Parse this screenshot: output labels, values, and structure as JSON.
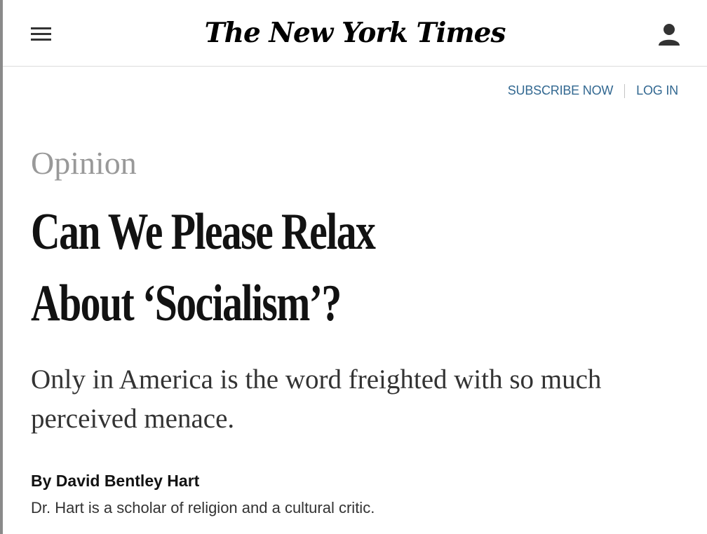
{
  "header": {
    "masthead": "The New York Times",
    "menu_icon": "hamburger-menu-icon",
    "account_icon": "user-account-icon"
  },
  "account_links": {
    "subscribe": "SUBSCRIBE NOW",
    "login": "LOG IN"
  },
  "article": {
    "kicker": "Opinion",
    "headline_lines": [
      "Can We Please Relax",
      "About ‘Socialism’?"
    ],
    "summary": "Only in America is the word freighted with so much perceived menace.",
    "byline": "By David Bentley Hart",
    "bio": "Dr. Hart is a scholar of religion and a cultural critic."
  },
  "colors": {
    "link": "#326891",
    "kicker": "#999999",
    "text": "#121212"
  }
}
